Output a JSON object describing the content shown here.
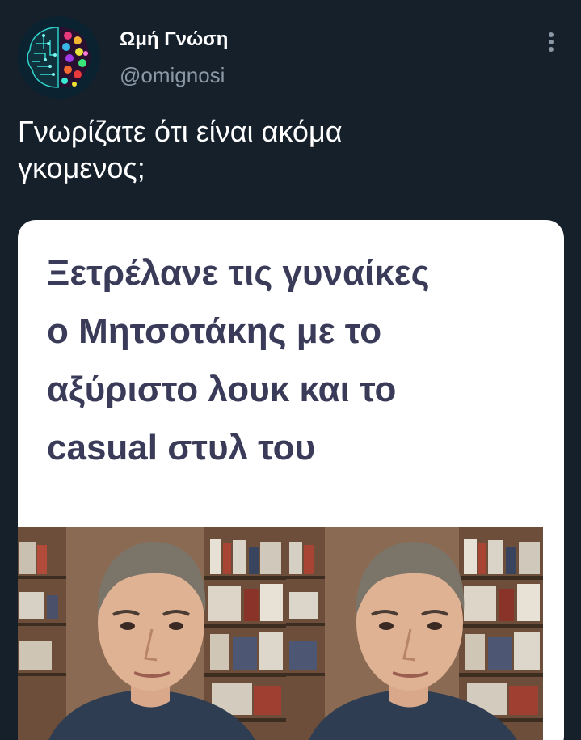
{
  "tweet": {
    "display_name": "Ωμή Γνώση",
    "handle": "@omignosi",
    "text": "Γνωρίζατε ότι είναι ακόμα\nγκομενος;",
    "more_icon": "vertical-dots-icon"
  },
  "media": {
    "headline": "Ξετρέλανε τις γυναίκες\nο Μητσοτάκης με το\nαξύριστο λουκ και το\ncasual στυλ του",
    "headline_color": "#3a3b59"
  },
  "colors": {
    "background": "#15202b",
    "text": "#ffffff",
    "secondary_text": "#8b98a5"
  }
}
